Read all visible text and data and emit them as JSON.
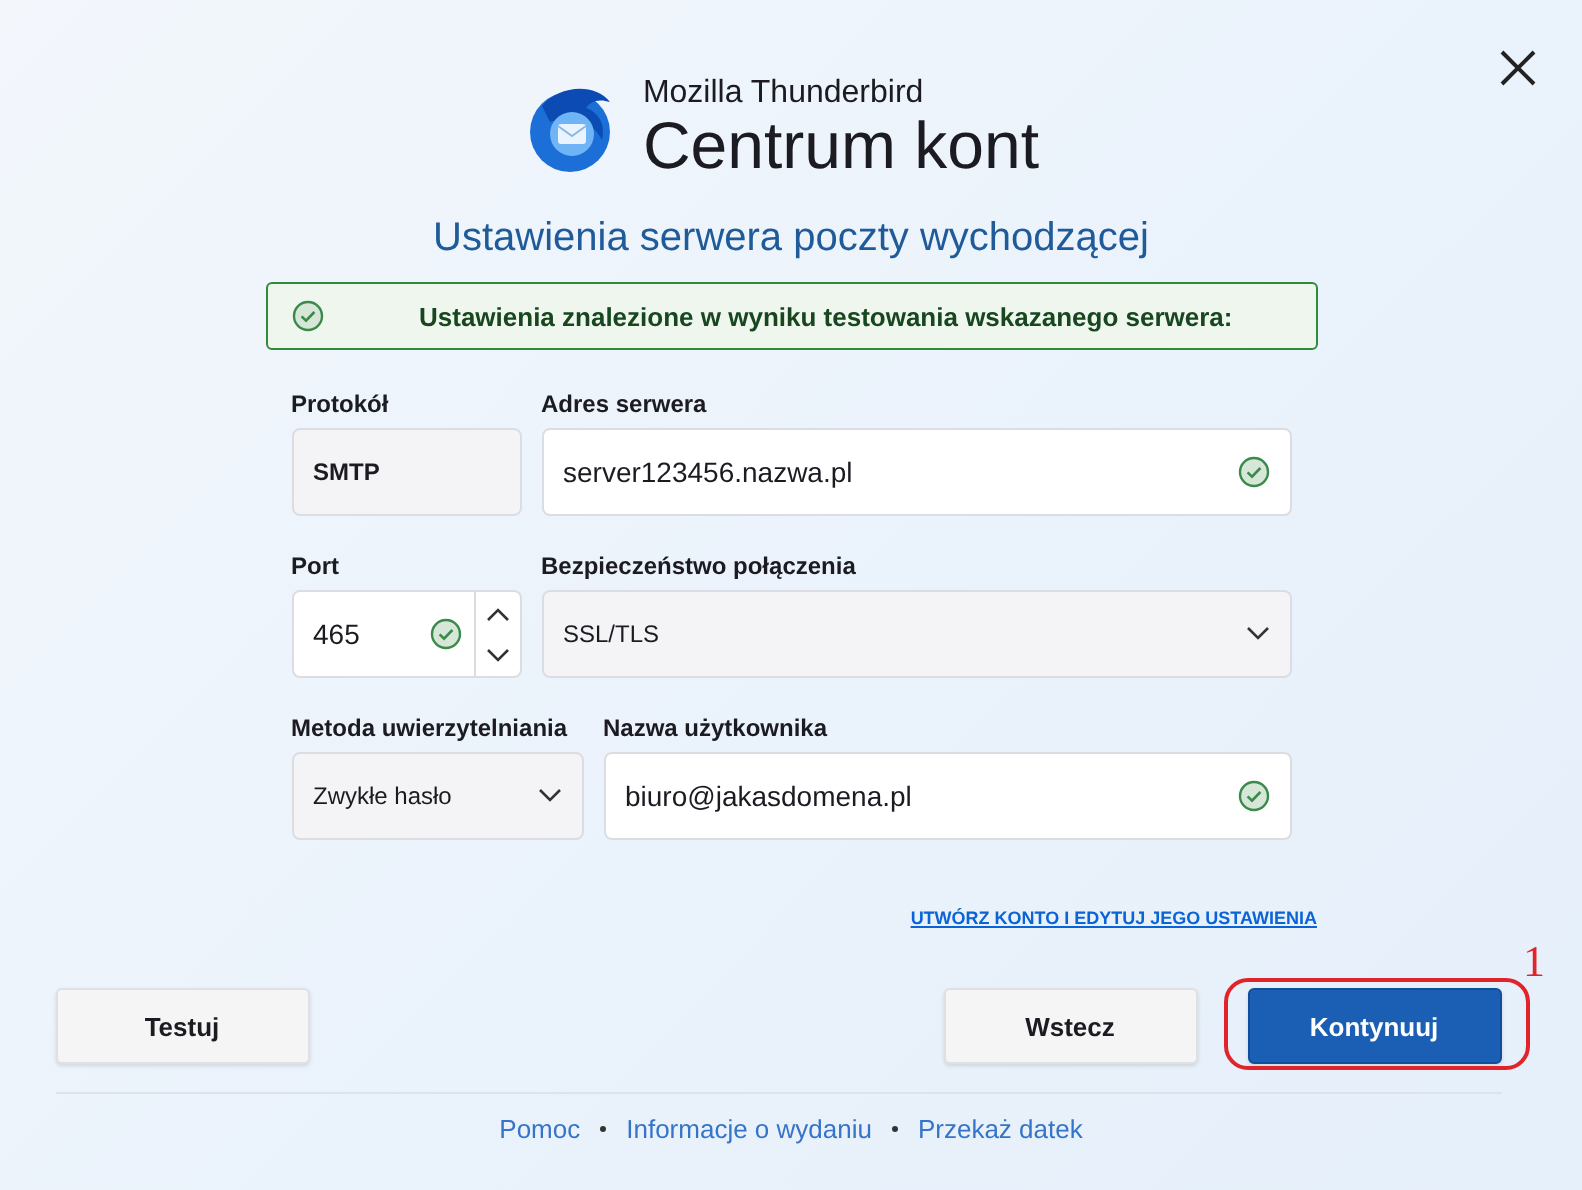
{
  "header": {
    "brand": "Mozilla Thunderbird",
    "title": "Centrum kont"
  },
  "heading": "Ustawienia serwera poczty wychodzącej",
  "notice": {
    "text": "Ustawienia znalezione w wyniku testowania wskazanego serwera:"
  },
  "protocol": {
    "label": "Protokół",
    "value": "SMTP"
  },
  "server": {
    "label": "Adres serwera",
    "value": "server123456.nazwa.pl",
    "valid": true
  },
  "port": {
    "label": "Port",
    "value": "465",
    "valid": true
  },
  "security": {
    "label": "Bezpieczeństwo połączenia",
    "value": "SSL/TLS"
  },
  "auth": {
    "label": "Metoda uwierzytelniania",
    "value": "Zwykłe hasło"
  },
  "username": {
    "label": "Nazwa użytkownika",
    "value": "biuro@jakasdomena.pl",
    "valid": true
  },
  "link": "UTWÓRZ KONTO I EDYTUJ JEGO USTAWIENIA",
  "buttons": [
    {
      "label": "Testuj",
      "primary": false
    },
    {
      "label": "Wstecz",
      "primary": false
    },
    {
      "label": "Kontynuuj",
      "primary": true
    }
  ],
  "annotation": {
    "label": "1"
  },
  "footer_links": [
    "Pomoc",
    "Informacje o wydaniu",
    "Przekaż datek"
  ]
}
